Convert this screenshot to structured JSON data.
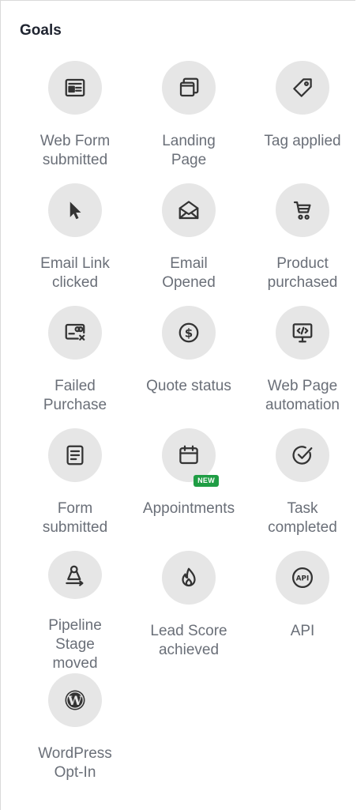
{
  "panel": {
    "title": "Goals"
  },
  "goals": [
    {
      "label": "Web Form\nsubmitted",
      "icon": "web-form-icon"
    },
    {
      "label": "Landing\nPage",
      "icon": "landing-page-icon"
    },
    {
      "label": "Tag applied",
      "icon": "tag-icon"
    },
    {
      "label": "Email Link\nclicked",
      "icon": "cursor-icon"
    },
    {
      "label": "Email\nOpened",
      "icon": "envelope-open-icon"
    },
    {
      "label": "Product\npurchased",
      "icon": "cart-icon"
    },
    {
      "label": "Failed\nPurchase",
      "icon": "card-x-icon"
    },
    {
      "label": "Quote status",
      "icon": "dollar-icon"
    },
    {
      "label": "Web Page\nautomation",
      "icon": "code-monitor-icon"
    },
    {
      "label": "Form\nsubmitted",
      "icon": "form-icon"
    },
    {
      "label": "Appointments",
      "icon": "calendar-icon",
      "badge": "NEW"
    },
    {
      "label": "Task\ncompleted",
      "icon": "check-circle-icon"
    },
    {
      "label": "Pipeline\nStage\nmoved",
      "icon": "pipeline-icon"
    },
    {
      "label": "Lead Score\nachieved",
      "icon": "flame-icon"
    },
    {
      "label": "API",
      "icon": "api-icon",
      "icon_text": "API"
    },
    {
      "label": "WordPress\nOpt-In",
      "icon": "wordpress-icon",
      "icon_text": "W"
    }
  ],
  "colors": {
    "icon_bg": "#e6e6e6",
    "icon_fg": "#333333",
    "label": "#6a6f78",
    "title": "#1f2430",
    "badge_bg": "#1f9d44"
  }
}
